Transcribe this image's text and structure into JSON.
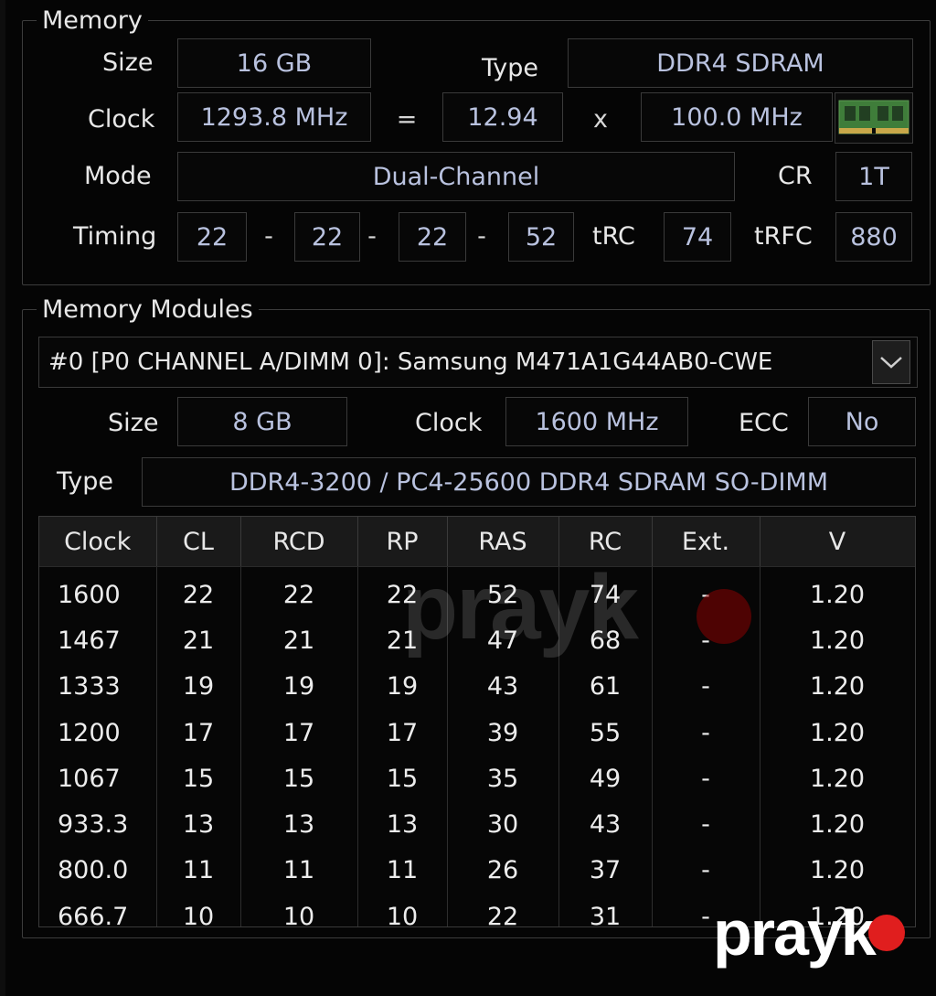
{
  "memory": {
    "legend": "Memory",
    "size_label": "Size",
    "size_value": "16 GB",
    "type_label": "Type",
    "type_value": "DDR4 SDRAM",
    "clock_label": "Clock",
    "clock_value": "1293.8 MHz",
    "eq": "=",
    "multiplier": "12.94",
    "x": "x",
    "bus_clock": "100.0 MHz",
    "mode_label": "Mode",
    "mode_value": "Dual-Channel",
    "cr_label": "CR",
    "cr_value": "1T",
    "timing_label": "Timing",
    "timings": [
      "22",
      "22",
      "22",
      "52"
    ],
    "dash": "-",
    "trc_label": "tRC",
    "trc_value": "74",
    "trfc_label": "tRFC",
    "trfc_value": "880"
  },
  "modules": {
    "legend": "Memory Modules",
    "selected_slot": "#0 [P0 CHANNEL A/DIMM 0]: Samsung M471A1G44AB0-CWE",
    "size_label": "Size",
    "size_value": "8 GB",
    "clock_label": "Clock",
    "clock_value": "1600 MHz",
    "ecc_label": "ECC",
    "ecc_value": "No",
    "type_label": "Type",
    "type_value": "DDR4-3200 / PC4-25600 DDR4 SDRAM SO-DIMM",
    "table": {
      "headers": [
        "Clock",
        "CL",
        "RCD",
        "RP",
        "RAS",
        "RC",
        "Ext.",
        "V"
      ],
      "rows": [
        [
          "1600",
          "22",
          "22",
          "22",
          "52",
          "74",
          "-",
          "1.20"
        ],
        [
          "1467",
          "21",
          "21",
          "21",
          "47",
          "68",
          "-",
          "1.20"
        ],
        [
          "1333",
          "19",
          "19",
          "19",
          "43",
          "61",
          "-",
          "1.20"
        ],
        [
          "1200",
          "17",
          "17",
          "17",
          "39",
          "55",
          "-",
          "1.20"
        ],
        [
          "1067",
          "15",
          "15",
          "15",
          "35",
          "49",
          "-",
          "1.20"
        ],
        [
          "933.3",
          "13",
          "13",
          "13",
          "30",
          "43",
          "-",
          "1.20"
        ],
        [
          "800.0",
          "11",
          "11",
          "11",
          "26",
          "37",
          "-",
          "1.20"
        ],
        [
          "666.7",
          "10",
          "10",
          "10",
          "22",
          "31",
          "-",
          "1.20"
        ]
      ]
    }
  },
  "watermark": {
    "text": "prayk",
    "dot_color": "#e01e1e"
  },
  "colors": {
    "value_text": "#b9c2df",
    "background": "#050505"
  },
  "icons": {
    "memory_module": "ram-stick-icon",
    "dropdown": "chevron-down-icon"
  }
}
